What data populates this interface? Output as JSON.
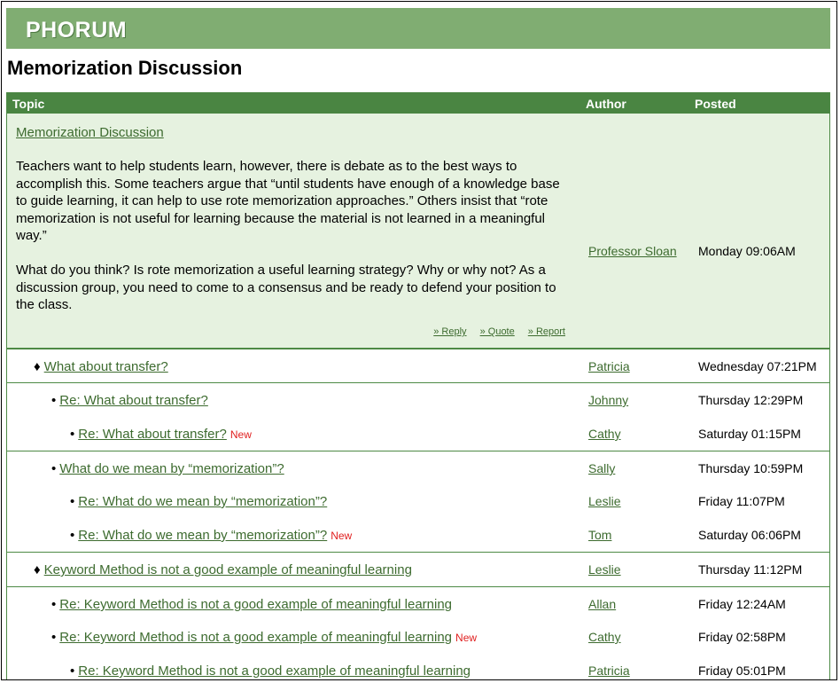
{
  "app": {
    "logo": "PHORUM"
  },
  "page": {
    "title": "Memorization Discussion"
  },
  "table": {
    "headers": {
      "topic": "Topic",
      "author": "Author",
      "posted": "Posted"
    }
  },
  "main_post": {
    "title": "Memorization Discussion",
    "paragraph1": "Teachers want to help students learn, however, there is debate as to the best ways to accomplish this. Some teachers argue that “until students have enough of a knowledge base to guide learning, it can help to use rote memorization approaches.” Others insist that “rote memorization is not useful for learning because the material is not learned in a meaningful way.”",
    "paragraph2": "What do you think? Is rote memorization a useful learning strategy? Why or why not? As a discussion group, you need to come to a consensus and be ready to defend your position to the class.",
    "author": "Professor Sloan",
    "posted": "Monday 09:06AM",
    "actions": {
      "reply": "» Reply",
      "quote": "» Quote",
      "report": "» Report"
    }
  },
  "threads": [
    {
      "bullet": "♦",
      "topic": "What about transfer?",
      "new": "",
      "author": "Patricia",
      "posted": "Wednesday 07:21PM"
    },
    {
      "bullet": "•",
      "topic": "Re: What about transfer?",
      "new": "",
      "author": "Johnny",
      "posted": "Thursday 12:29PM"
    },
    {
      "bullet": "•",
      "topic": "Re: What about transfer?",
      "new": "New",
      "author": "Cathy",
      "posted": "Saturday 01:15PM"
    },
    {
      "bullet": "•",
      "topic": "What do we mean by “memorization”?",
      "new": "",
      "author": "Sally",
      "posted": "Thursday 10:59PM"
    },
    {
      "bullet": "•",
      "topic": "Re: What do we mean by “memorization”?",
      "new": "",
      "author": "Leslie",
      "posted": "Friday 11:07PM"
    },
    {
      "bullet": "•",
      "topic": "Re: What do we mean by “memorization”?",
      "new": "New",
      "author": "Tom",
      "posted": "Saturday 06:06PM"
    },
    {
      "bullet": "♦",
      "topic": "Keyword Method is not a good example of meaningful learning",
      "new": "",
      "author": "Leslie",
      "posted": "Thursday 11:12PM"
    },
    {
      "bullet": "•",
      "topic": "Re: Keyword Method is not a good example of meaningful learning",
      "new": "",
      "author": "Allan",
      "posted": "Friday 12:24AM"
    },
    {
      "bullet": "•",
      "topic": "Re: Keyword Method is not a good example of meaningful learning",
      "new": "New",
      "author": "Cathy",
      "posted": "Friday 02:58PM"
    },
    {
      "bullet": "•",
      "topic": "Re: Keyword Method is not a good example of meaningful learning",
      "new": "",
      "author": "Patricia",
      "posted": "Friday 05:01PM"
    }
  ],
  "colors": {
    "banner": "#80ad72",
    "header": "#4a8542",
    "link": "#3d6b2f",
    "post_bg": "#e6f2e0",
    "new": "#e02020"
  }
}
